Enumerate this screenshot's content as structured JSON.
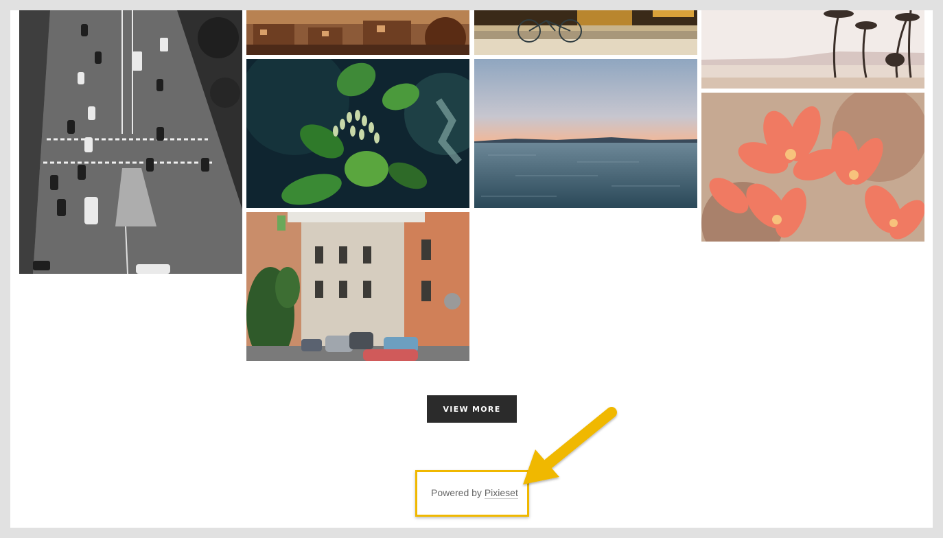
{
  "gallery": {
    "photos": [
      {
        "subject": "aerial black and white street with cars"
      },
      {
        "subject": "town rooftops at sunset"
      },
      {
        "subject": "bicycle on street"
      },
      {
        "subject": "beach with palm trees"
      },
      {
        "subject": "green leaves and buds"
      },
      {
        "subject": "calm sea at dusk"
      },
      {
        "subject": "coral flowers"
      },
      {
        "subject": "italian street with old buildings"
      }
    ],
    "view_more_label": "VIEW MORE"
  },
  "footer": {
    "powered_prefix": "Powered by ",
    "powered_link": "Pixieset"
  },
  "annotation": {
    "highlight_color": "#f0b800",
    "arrow_icon": "arrow-pointing-down-left-icon"
  }
}
